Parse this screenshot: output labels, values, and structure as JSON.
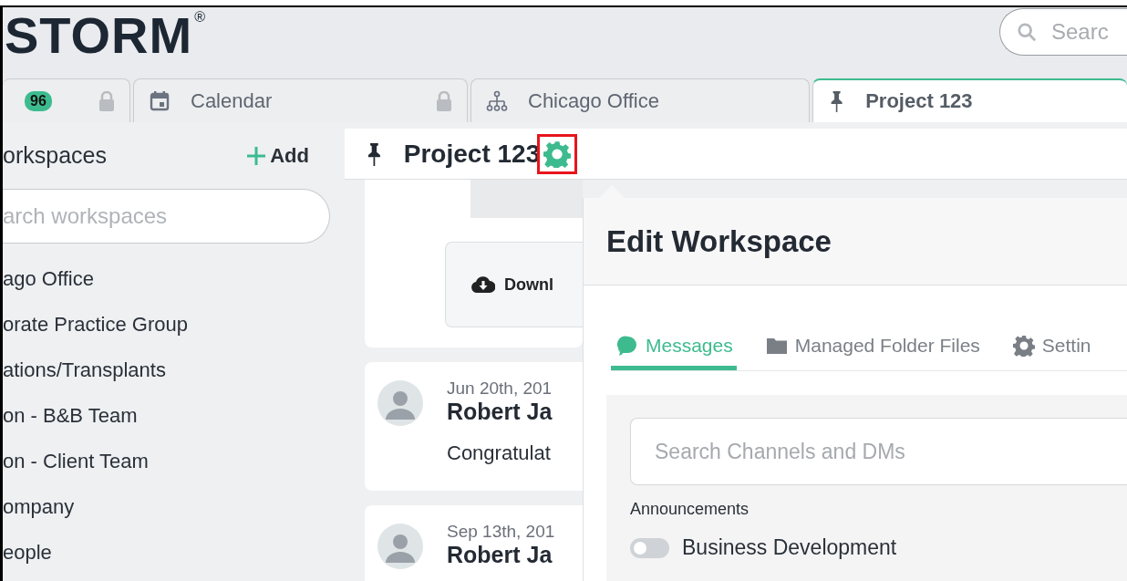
{
  "logo": {
    "text": "STORM",
    "mark": "®"
  },
  "search": {
    "placeholder": "Searc"
  },
  "tabs": [
    {
      "badge": "96",
      "locked": true,
      "selected": false
    },
    {
      "label": "Calendar",
      "locked": true,
      "selected": false
    },
    {
      "label": "Chicago Office",
      "locked": false,
      "selected": false
    },
    {
      "label": "Project 123",
      "locked": false,
      "selected": true
    }
  ],
  "sidebar": {
    "title": "orkspaces",
    "add_label": "Add",
    "search_placeholder": "arch workspaces",
    "items": [
      {
        "label": "ago Office"
      },
      {
        "label": "orate Practice Group"
      },
      {
        "label": "ations/Transplants"
      },
      {
        "label": "on - B&B Team"
      },
      {
        "label": "on - Client Team"
      },
      {
        "label": "ompany"
      },
      {
        "label": "eople"
      }
    ]
  },
  "workspace": {
    "title": "Project 123",
    "settings_highlighted": true
  },
  "feed": {
    "download_label": "Downl",
    "posts": [
      {
        "date": "Jun 20th, 201",
        "author": "Robert Ja",
        "text": "Congratulat"
      },
      {
        "date": "Sep 13th, 201",
        "author": "Robert Ja"
      }
    ]
  },
  "modal": {
    "title": "Edit Workspace",
    "tabs": [
      {
        "label": "Messages",
        "selected": true
      },
      {
        "label": "Managed Folder Files",
        "selected": false
      },
      {
        "label": "Settin",
        "selected": false
      }
    ],
    "search_placeholder": "Search Channels and DMs",
    "section": "Announcements",
    "channels": [
      {
        "name": "Business Development",
        "on": false
      }
    ]
  }
}
